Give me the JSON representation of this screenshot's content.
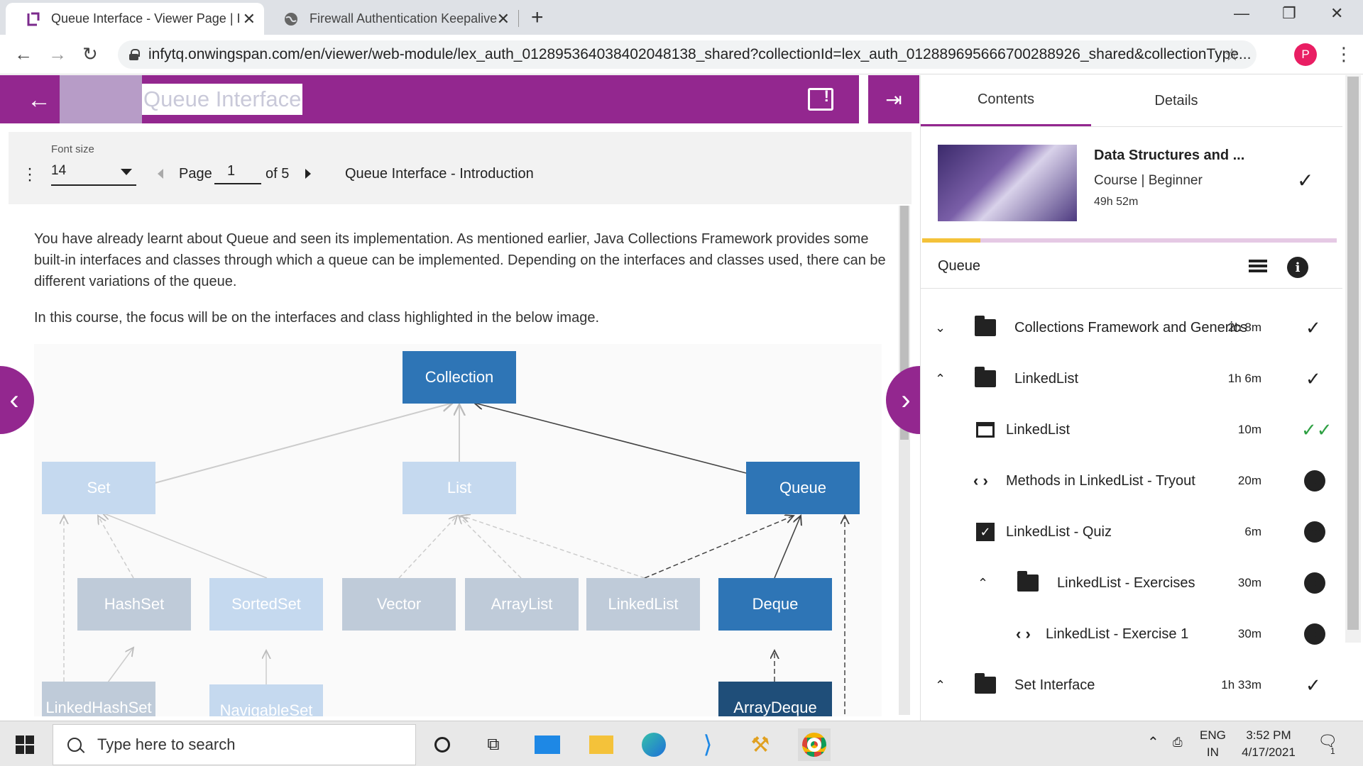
{
  "browser": {
    "tabs": [
      {
        "title": "Queue Interface - Viewer Page | I",
        "active": true
      },
      {
        "title": "Firewall Authentication Keepalive",
        "active": false
      }
    ],
    "url": "infytq.onwingspan.com/en/viewer/web-module/lex_auth_012895364038402048138_shared?collectionId=lex_auth_012889695666700288926_shared&collectionType...",
    "profile_initial": "P"
  },
  "viewer": {
    "title": "Queue Interface",
    "font_size_label": "Font size",
    "font_size_value": "14",
    "page_label": "Page",
    "page_current": "1",
    "page_of": "of 5",
    "section_title": "Queue Interface - Introduction",
    "paragraph1": "You have already learnt about Queue and seen its implementation. As mentioned earlier, Java Collections Framework provides some built-in interfaces and classes through which a queue can be implemented. Depending on the interfaces and classes used, there can be different variations of the queue.",
    "paragraph2": "In this course, the focus will be on the interfaces and class highlighted in the below image."
  },
  "diagram": {
    "nodes": {
      "collection": "Collection",
      "set": "Set",
      "list": "List",
      "queue": "Queue",
      "hashset": "HashSet",
      "sortedset": "SortedSet",
      "vector": "Vector",
      "arraylist": "ArrayList",
      "linkedlist": "LinkedList",
      "deque": "Deque",
      "linkedhashset": "LinkedHashSet",
      "navigableset": "NavigableSet",
      "arraydeque": "ArrayDeque"
    },
    "colors": {
      "highlight": "#2e75b6",
      "light": "#c5d9ef",
      "grey": "#bfcbd9",
      "dark": "#1f4e79"
    }
  },
  "panel": {
    "tabs": [
      "Contents",
      "Details"
    ],
    "course": {
      "title": "Data Structures and ...",
      "type": "Course",
      "level": "Beginner",
      "duration": "49h 52m",
      "progress_fraction": 0.14
    },
    "section_label": "Queue",
    "items": [
      {
        "label": "Collections Framework and Generics",
        "duration": "2h 8m",
        "status": "check"
      },
      {
        "label": "LinkedList",
        "duration": "1h 6m",
        "status": "check"
      },
      {
        "label": "LinkedList",
        "duration": "10m",
        "status": "double-check"
      },
      {
        "label": "Methods in LinkedList - Tryout",
        "duration": "20m",
        "status": "more"
      },
      {
        "label": "LinkedList - Quiz",
        "duration": "6m",
        "status": "more"
      },
      {
        "label": "LinkedList - Exercises",
        "duration": "30m",
        "status": "more"
      },
      {
        "label": "LinkedList - Exercise 1",
        "duration": "30m",
        "status": "more"
      },
      {
        "label": "Set Interface",
        "duration": "1h 33m",
        "status": "check"
      }
    ]
  },
  "taskbar": {
    "search_placeholder": "Type here to search",
    "lang_top": "ENG",
    "lang_bottom": "IN",
    "time": "3:52 PM",
    "date": "4/17/2021",
    "notifications": "1"
  }
}
